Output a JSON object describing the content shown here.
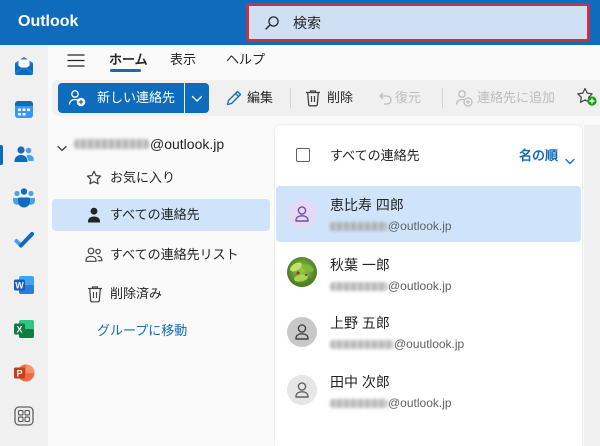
{
  "app": {
    "title": "Outlook"
  },
  "search": {
    "placeholder": "検索",
    "icon": "search-icon"
  },
  "colors": {
    "accent": "#0f6cbd",
    "selected_bg": "#cfe4fa",
    "search_highlight_border": "#c4314b",
    "disabled_text": "#bdbdbd"
  },
  "rail": {
    "items": [
      {
        "icon": "mail-icon"
      },
      {
        "icon": "calendar-icon"
      },
      {
        "icon": "people-icon",
        "active": true
      },
      {
        "icon": "teams-icon"
      },
      {
        "icon": "todo-icon"
      },
      {
        "icon": "word-icon",
        "logo_letter": "W"
      },
      {
        "icon": "excel-icon",
        "logo_letter": "X"
      },
      {
        "icon": "powerpoint-icon",
        "logo_letter": "P"
      },
      {
        "icon": "apps-icon"
      }
    ]
  },
  "ribbon": {
    "menu_icon": "hamburger-icon",
    "tabs": [
      {
        "label": "ホーム",
        "active": true
      },
      {
        "label": "表示",
        "active": false
      },
      {
        "label": "ヘルプ",
        "active": false
      }
    ]
  },
  "toolbar": {
    "new_contact": {
      "label": "新しい連絡先",
      "icon": "person-add-icon",
      "dropdown_icon": "chevron-down-icon"
    },
    "edit": {
      "label": "編集",
      "icon": "pencil-icon",
      "enabled": true
    },
    "delete": {
      "label": "削除",
      "icon": "trash-icon",
      "enabled": true
    },
    "restore": {
      "label": "復元",
      "icon": "undo-icon",
      "enabled": false
    },
    "add_to_contacts": {
      "label": "連絡先に追加",
      "icon": "person-add-icon",
      "enabled": false
    },
    "add_favorite": {
      "icon": "star-add-icon"
    }
  },
  "folders": {
    "account": {
      "address_visible": "@outlook.jp",
      "expanded": true
    },
    "items": [
      {
        "label": "お気に入り",
        "icon": "star-icon",
        "selected": false
      },
      {
        "label": "すべての連絡先",
        "icon": "person-icon",
        "selected": true
      },
      {
        "label": "すべての連絡先リスト",
        "icon": "people-list-icon",
        "selected": false
      },
      {
        "label": "削除済み",
        "icon": "trash-icon",
        "selected": false
      }
    ],
    "group_link": "グループに移動"
  },
  "list": {
    "header": "すべての連絡先",
    "sort_label": "名の順",
    "contacts": [
      {
        "name": "恵比寿 四郎",
        "email_domain": "@outlook.jp",
        "avatar": "person-icon",
        "selected": true
      },
      {
        "name": "秋葉 一郎",
        "email_domain": "@outlook.jp",
        "avatar": "photo",
        "selected": false
      },
      {
        "name": "上野 五郎",
        "email_domain": "@ouutlook.jp",
        "avatar": "person-icon",
        "selected": false
      },
      {
        "name": "田中 次郎",
        "email_domain": "@outlook.jp",
        "avatar": "person-icon",
        "selected": false
      }
    ]
  }
}
